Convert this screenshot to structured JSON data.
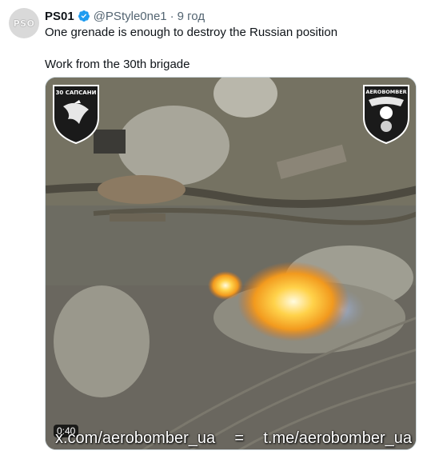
{
  "account": {
    "avatar_text": "PSO",
    "display_name": "PS01",
    "handle": "@PStyle0ne1",
    "separator": "·",
    "time": "9 год",
    "verified_color": "#1d9bf0"
  },
  "tweet": {
    "line1": "One grenade is enough to destroy the Russian position",
    "line2": "Work from the 30th brigade"
  },
  "video": {
    "duration": "0:40",
    "logo_left_text": "30 САПСАНИ",
    "logo_right_text": "AEROBOMBER",
    "watermark_left": "x.com/aerobomber_ua",
    "watermark_sep": "=",
    "watermark_right": "t.me/aerobomber_ua"
  }
}
